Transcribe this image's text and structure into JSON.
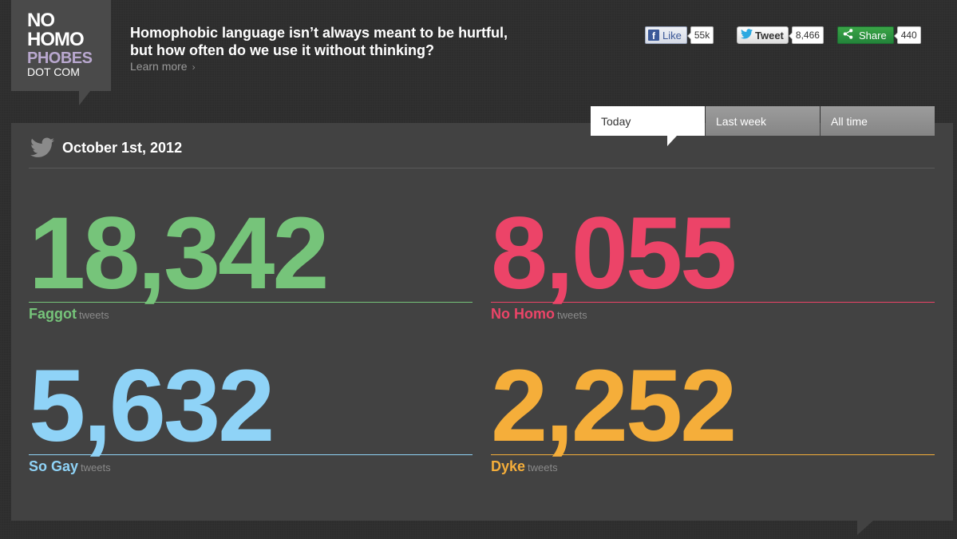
{
  "logo": {
    "line1": "NO",
    "line2": "HOMO",
    "line3": "PHOBES",
    "line4": "DOT COM"
  },
  "headline": {
    "text_line1": "Homophobic language isn’t always meant to be hurtful,",
    "text_line2": "but how often do we use it without thinking?",
    "learn_more": "Learn more",
    "chevron": "›"
  },
  "social": {
    "facebook": {
      "label": "Like",
      "icon": "f",
      "count": "55k"
    },
    "twitter": {
      "label": "Tweet",
      "count": "8,466"
    },
    "share": {
      "label": "Share",
      "count": "440"
    }
  },
  "tabs": [
    {
      "label": "Today",
      "active": true
    },
    {
      "label": "Last week",
      "active": false
    },
    {
      "label": "All time",
      "active": false
    }
  ],
  "date": "October 1st, 2012",
  "stats": [
    {
      "number": "18,342",
      "term": "Faggot",
      "suffix": "tweets",
      "color": "#76c47a"
    },
    {
      "number": "8,055",
      "term": "No Homo",
      "suffix": "tweets",
      "color": "#ec4468"
    },
    {
      "number": "5,632",
      "term": "So Gay",
      "suffix": "tweets",
      "color": "#8fd3f7"
    },
    {
      "number": "2,252",
      "term": "Dyke",
      "suffix": "tweets",
      "color": "#f5ae3a"
    }
  ]
}
